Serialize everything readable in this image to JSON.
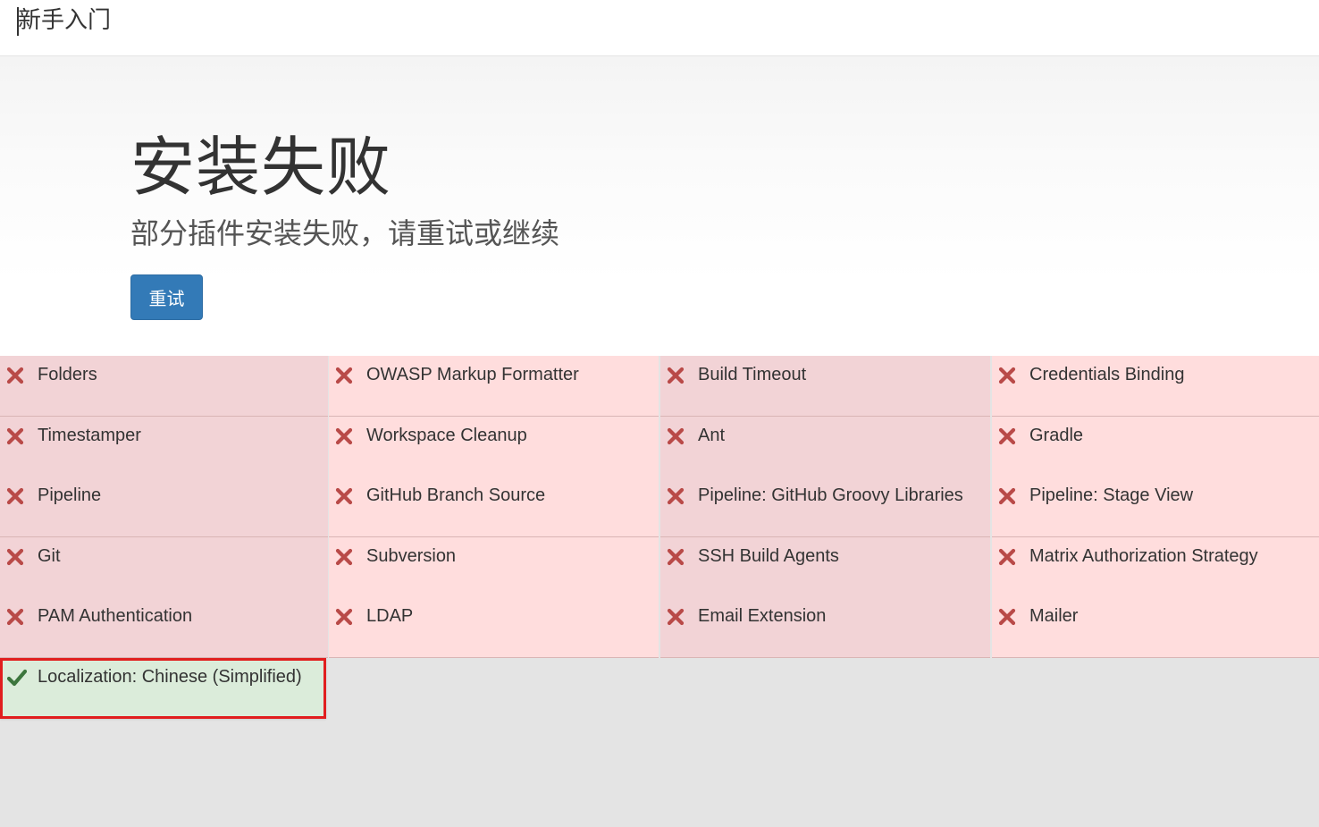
{
  "header": {
    "title": "新手入门"
  },
  "hero": {
    "heading": "安装失败",
    "subheading": "部分插件安装失败，请重试或继续",
    "retry_label": "重试"
  },
  "colors": {
    "failed_a": "#f2d3d6",
    "failed_b": "#ffdddd",
    "success": "#dbecda",
    "fail_icon": "#b94a48",
    "success_icon": "#3c763d",
    "highlight_border": "#e11e1e",
    "button": "#337ab7"
  },
  "plugins": [
    {
      "name": "Folders",
      "status": "failed",
      "icon": "cross-icon"
    },
    {
      "name": "OWASP Markup Formatter",
      "status": "failed",
      "icon": "cross-icon"
    },
    {
      "name": "Build Timeout",
      "status": "failed",
      "icon": "cross-icon"
    },
    {
      "name": "Credentials Binding",
      "status": "failed",
      "icon": "cross-icon"
    },
    {
      "name": "Timestamper",
      "status": "failed",
      "icon": "cross-icon"
    },
    {
      "name": "Workspace Cleanup",
      "status": "failed",
      "icon": "cross-icon"
    },
    {
      "name": "Ant",
      "status": "failed",
      "icon": "cross-icon"
    },
    {
      "name": "Gradle",
      "status": "failed",
      "icon": "cross-icon"
    },
    {
      "name": "Pipeline",
      "status": "failed",
      "icon": "cross-icon"
    },
    {
      "name": "GitHub Branch Source",
      "status": "failed",
      "icon": "cross-icon"
    },
    {
      "name": "Pipeline: GitHub Groovy Libraries",
      "status": "failed",
      "icon": "cross-icon"
    },
    {
      "name": "Pipeline: Stage View",
      "status": "failed",
      "icon": "cross-icon"
    },
    {
      "name": "Git",
      "status": "failed",
      "icon": "cross-icon"
    },
    {
      "name": "Subversion",
      "status": "failed",
      "icon": "cross-icon"
    },
    {
      "name": "SSH Build Agents",
      "status": "failed",
      "icon": "cross-icon"
    },
    {
      "name": "Matrix Authorization Strategy",
      "status": "failed",
      "icon": "cross-icon"
    },
    {
      "name": "PAM Authentication",
      "status": "failed",
      "icon": "cross-icon"
    },
    {
      "name": "LDAP",
      "status": "failed",
      "icon": "cross-icon"
    },
    {
      "name": "Email Extension",
      "status": "failed",
      "icon": "cross-icon"
    },
    {
      "name": "Mailer",
      "status": "failed",
      "icon": "cross-icon"
    },
    {
      "name": "Localization: Chinese (Simplified)",
      "status": "success",
      "icon": "check-icon"
    }
  ]
}
